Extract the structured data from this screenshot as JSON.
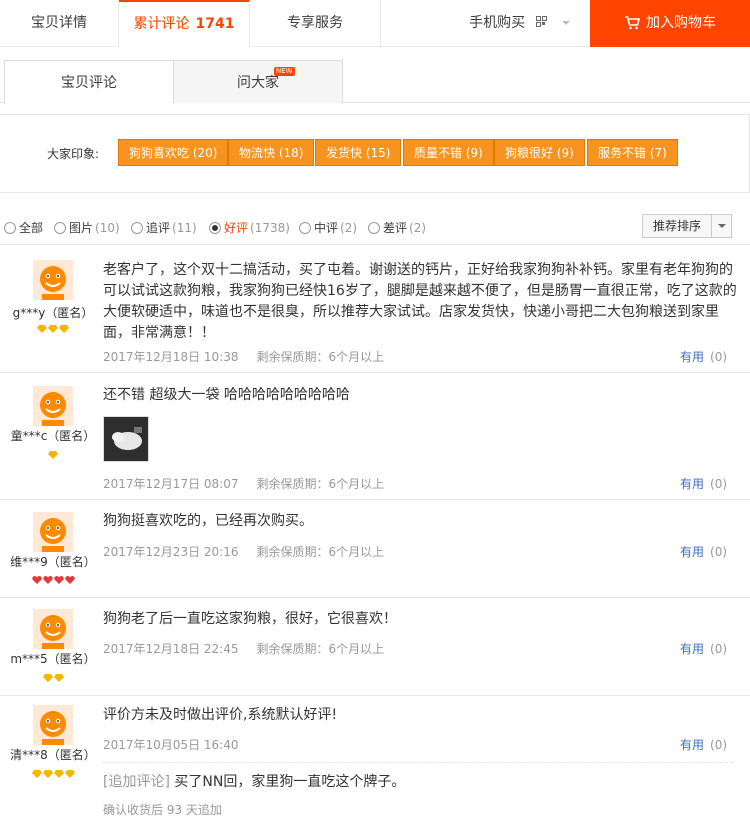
{
  "top_tabs": {
    "detail": "宝贝详情",
    "reviews_label": "累计评论",
    "reviews_count": "1741",
    "service": "专享服务",
    "mobile": "手机购买",
    "cart": "加入购物车"
  },
  "sub_tabs": {
    "reviews": "宝贝评论",
    "ask": "问大家",
    "new_badge": "NEW"
  },
  "impressions": {
    "label": "大家印象:",
    "tags": [
      "狗狗喜欢吃 (20)",
      "物流快 (18)",
      "发货快 (15)",
      "质量不错 (9)",
      "狗粮很好 (9)",
      "服务不错 (7)"
    ]
  },
  "filters": [
    {
      "label": "全部",
      "count": ""
    },
    {
      "label": "图片",
      "count": "(10)"
    },
    {
      "label": "追评",
      "count": "(11)"
    },
    {
      "label": "好评",
      "count": "(1738)"
    },
    {
      "label": "中评",
      "count": "(2)"
    },
    {
      "label": "差评",
      "count": "(2)"
    }
  ],
  "sort": {
    "label": "推荐排序"
  },
  "reviews": [
    {
      "user": "g***y（匿名）",
      "text": "老客户了，这个双十二搞活动，买了屯着。谢谢送的钙片，正好给我家狗狗补补钙。家里有老年狗狗的可以试试这款狗粮，我家狗狗已经快16岁了，腿脚是越来越不便了，但是肠胃一直很正常，吃了这款的大便软硬适中，味道也不是很臭，所以推荐大家试试。店家发货快，快递小哥把二大包狗粮送到家里面，非常满意！！",
      "date": "2017年12月18日 10:38",
      "shelf": "剩余保质期：6个月以上",
      "useful": "有用",
      "useful_count": "(0)",
      "badge": "gold3"
    },
    {
      "user": "童***c（匿名）",
      "text": "还不错 超级大一袋 哈哈哈哈哈哈哈哈哈",
      "date": "2017年12月17日 08:07",
      "shelf": "剩余保质期：6个月以上",
      "useful": "有用",
      "useful_count": "(0)",
      "badge": "gold1"
    },
    {
      "user": "维***9（匿名）",
      "text": "狗狗挺喜欢吃的，已经再次购买。",
      "date": "2017年12月23日 20:16",
      "shelf": "剩余保质期：6个月以上",
      "useful": "有用",
      "useful_count": "(0)",
      "badge": "red4"
    },
    {
      "user": "m***5（匿名）",
      "text": "狗狗老了后一直吃这家狗粮，很好，它很喜欢！",
      "date": "2017年12月18日 22:45",
      "shelf": "剩余保质期：6个月以上",
      "useful": "有用",
      "useful_count": "(0)",
      "badge": "gold2"
    },
    {
      "user": "清***8（匿名）",
      "text": "评价方未及时做出评价,系统默认好评!",
      "date": "2017年10月05日 16:40",
      "shelf": "",
      "useful": "有用",
      "useful_count": "(0)",
      "badge": "gold4",
      "append_label": "[追加评论]",
      "append_text": "买了NN回，家里狗一直吃这个牌子。",
      "append_note": "确认收货后 93 天追加"
    }
  ],
  "colors": {
    "accent": "#ff4400",
    "tag": "#f7931e",
    "link": "#3d6ec2"
  }
}
